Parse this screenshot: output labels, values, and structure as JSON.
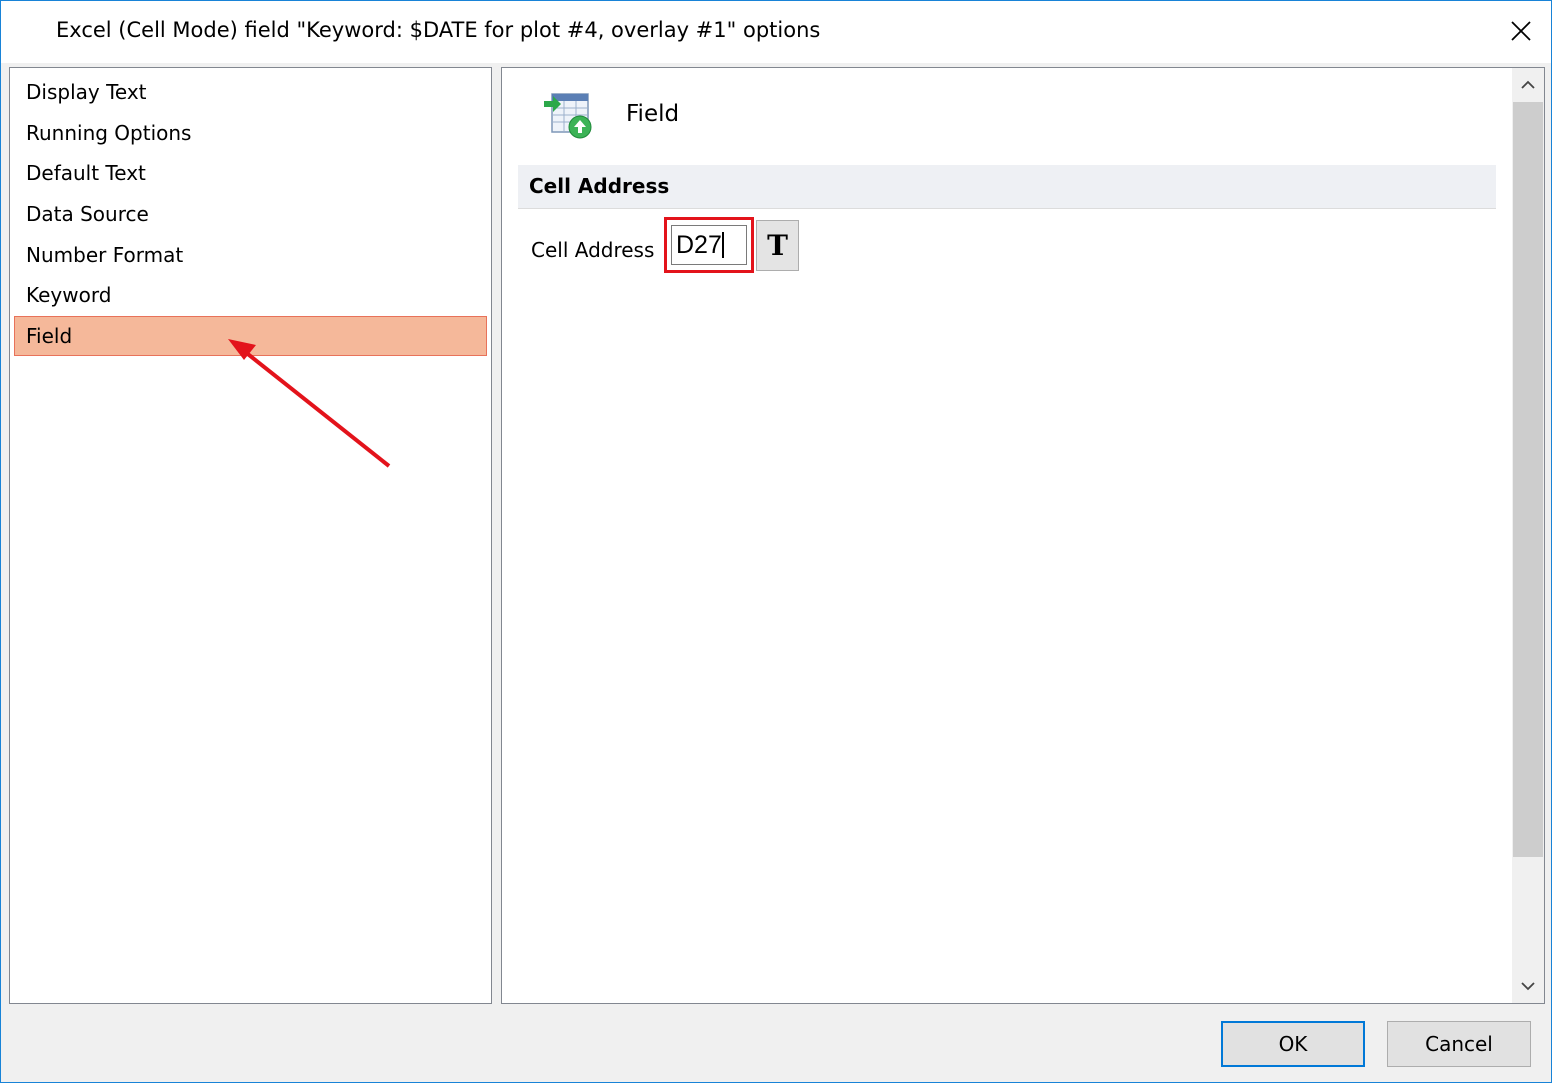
{
  "window": {
    "title": "Excel (Cell Mode) field \"Keyword: $DATE for plot #4, overlay #1\" options"
  },
  "nav": {
    "items": [
      {
        "label": "Display Text"
      },
      {
        "label": "Running Options"
      },
      {
        "label": "Default Text"
      },
      {
        "label": "Data Source"
      },
      {
        "label": "Number Format"
      },
      {
        "label": "Keyword"
      },
      {
        "label": "Field",
        "selected": true
      }
    ]
  },
  "content": {
    "header_title": "Field",
    "header_icon": "table-import-icon",
    "section_title": "Cell Address",
    "cell_address_label": "Cell Address",
    "cell_address_value": "D27",
    "text_button_label": "T"
  },
  "footer": {
    "ok_label": "OK",
    "cancel_label": "Cancel"
  },
  "colors": {
    "selected_bg": "#f5b89a",
    "annotation_red": "#e3131b",
    "accent": "#0078d7"
  }
}
